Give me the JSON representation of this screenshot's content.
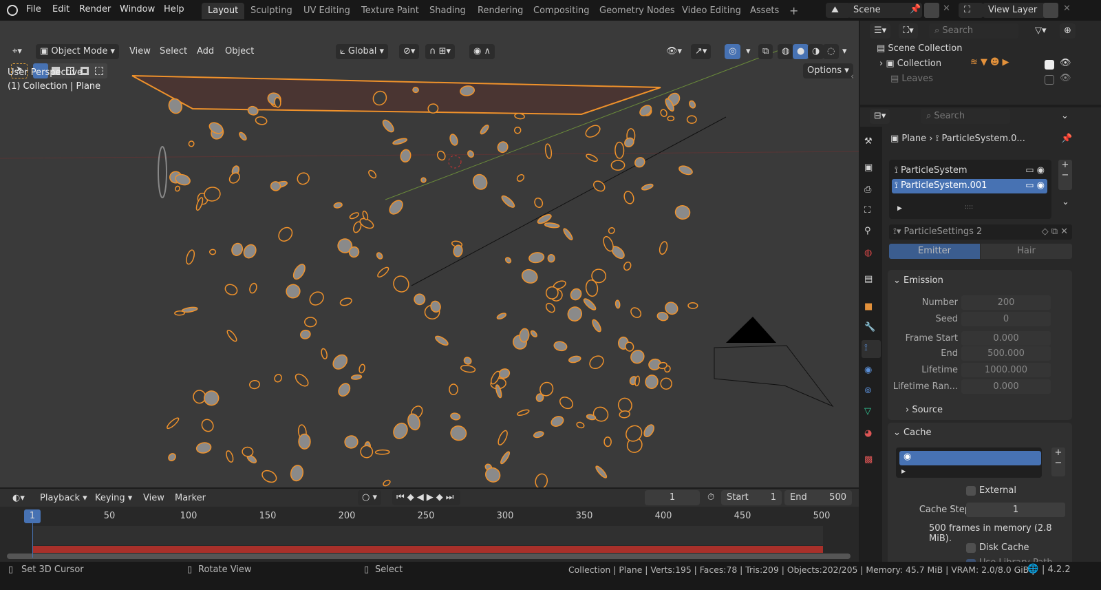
{
  "menu": [
    "File",
    "Edit",
    "Render",
    "Window",
    "Help"
  ],
  "workspaces": [
    "Layout",
    "Sculpting",
    "UV Editing",
    "Texture Paint",
    "Shading",
    "Rendering",
    "Compositing",
    "Geometry Nodes",
    "Video Editing",
    "Assets"
  ],
  "workspace_add": "+",
  "scene": "Scene",
  "view_layer": "View Layer",
  "viewport": {
    "mode": "Object Mode",
    "menus": [
      "View",
      "Select",
      "Add",
      "Object"
    ],
    "transform_orientation": "Global",
    "options": "Options",
    "overlay_title": "User Perspective",
    "overlay_sub": "(1) Collection | Plane"
  },
  "outliner": {
    "search_placeholder": "Search",
    "items": [
      {
        "label": "Scene Collection"
      },
      {
        "label": "Collection",
        "checked": true
      },
      {
        "label": "Leaves",
        "checked": false
      }
    ]
  },
  "properties": {
    "search_placeholder": "Search",
    "breadcrumb": [
      "Plane",
      "ParticleSystem.0..."
    ],
    "systems": [
      {
        "label": "ParticleSystem",
        "selected": false
      },
      {
        "label": "ParticleSystem.001",
        "selected": true
      }
    ],
    "settings_name": "ParticleSettings 2",
    "type_tabs": [
      "Emitter",
      "Hair"
    ],
    "emission": {
      "title": "Emission",
      "fields": [
        {
          "label": "Number",
          "value": "200"
        },
        {
          "label": "Seed",
          "value": "0"
        },
        {
          "label": "Frame Start",
          "value": "0.000"
        },
        {
          "label": "End",
          "value": "500.000"
        },
        {
          "label": "Lifetime",
          "value": "1000.000"
        },
        {
          "label": "Lifetime Ran...",
          "value": "0.000"
        }
      ],
      "source": "Source"
    },
    "cache": {
      "title": "Cache",
      "external": "External",
      "cache_step_label": "Cache Step",
      "cache_step": "1",
      "info": "500 frames in memory (2.8 MiB).",
      "disk_cache": "Disk Cache",
      "use_library_path": "Use Library Path"
    }
  },
  "timeline": {
    "menus": [
      "Playback",
      "Keying",
      "View",
      "Marker"
    ],
    "current_frame": "1",
    "start_label": "Start",
    "start": "1",
    "end_label": "End",
    "end": "500",
    "ticks": [
      "50",
      "100",
      "150",
      "200",
      "250",
      "300",
      "350",
      "400",
      "450",
      "500"
    ],
    "playhead": "1"
  },
  "status": {
    "hints": [
      "Set 3D Cursor",
      "Rotate View",
      "Select"
    ],
    "stats": "Collection | Plane | Verts:195 | Faces:78 | Tris:209 | Objects:202/205 | Memory: 45.7 MiB | VRAM: 2.0/8.0 GiB |",
    "version": "| 4.2.2"
  },
  "colors": {
    "accent": "#4772b3",
    "selection": "#f0922b",
    "cache_bar": "#a8302a"
  }
}
